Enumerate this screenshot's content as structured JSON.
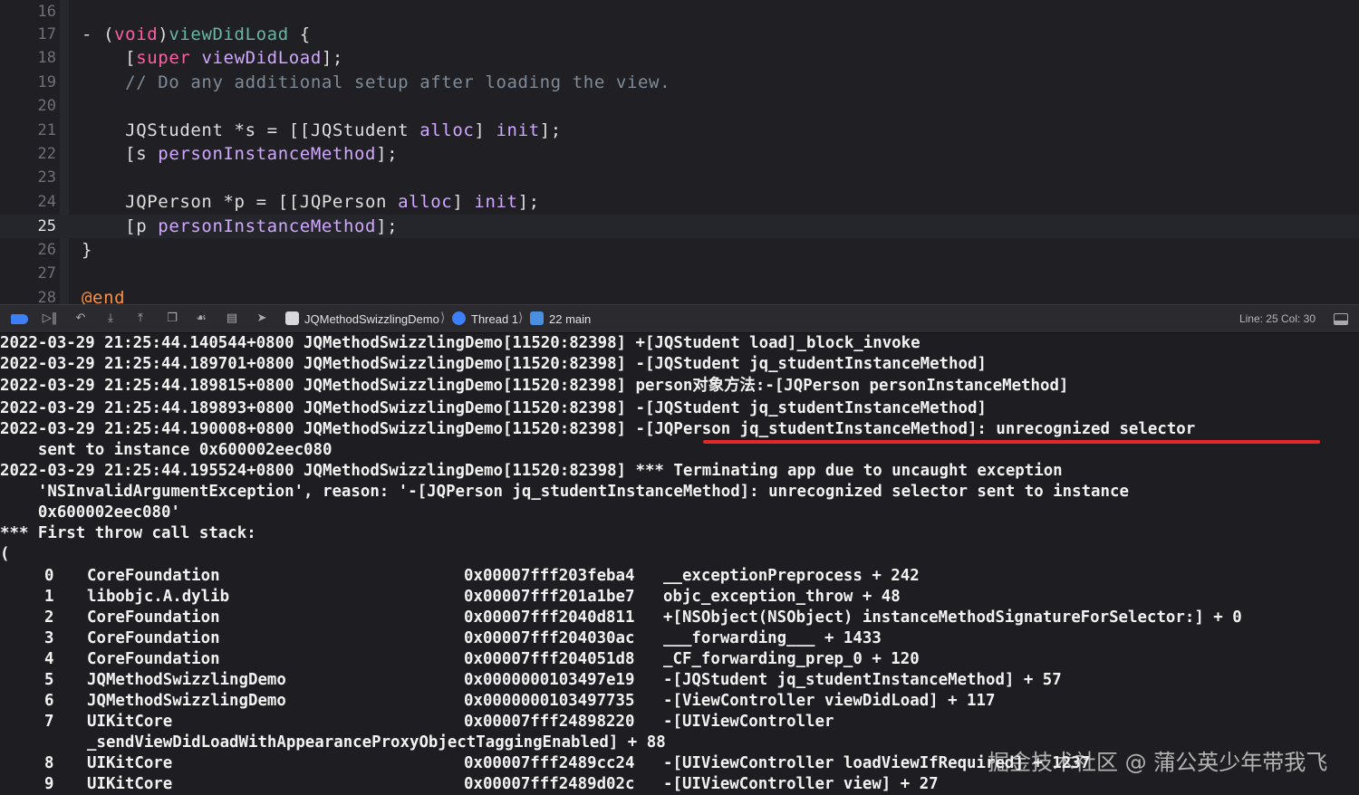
{
  "editor": {
    "lines": [
      {
        "num": "16",
        "tokens": []
      },
      {
        "num": "17",
        "tokens": [
          {
            "t": "- (",
            "c": ""
          },
          {
            "t": "void",
            "c": "kw"
          },
          {
            "t": ")",
            "c": ""
          },
          {
            "t": "viewDidLoad",
            "c": "fn"
          },
          {
            "t": " {",
            "c": ""
          }
        ]
      },
      {
        "num": "18",
        "tokens": [
          {
            "t": "    [",
            "c": ""
          },
          {
            "t": "super",
            "c": "kw"
          },
          {
            "t": " ",
            "c": ""
          },
          {
            "t": "viewDidLoad",
            "c": "cls"
          },
          {
            "t": "];",
            "c": ""
          }
        ]
      },
      {
        "num": "19",
        "tokens": [
          {
            "t": "    // Do any additional setup after loading the view.",
            "c": "cm"
          }
        ]
      },
      {
        "num": "20",
        "tokens": []
      },
      {
        "num": "21",
        "tokens": [
          {
            "t": "    JQStudent *s = [[JQStudent ",
            "c": ""
          },
          {
            "t": "alloc",
            "c": "cls"
          },
          {
            "t": "] ",
            "c": ""
          },
          {
            "t": "init",
            "c": "cls"
          },
          {
            "t": "];",
            "c": ""
          }
        ]
      },
      {
        "num": "22",
        "tokens": [
          {
            "t": "    [s ",
            "c": ""
          },
          {
            "t": "personInstanceMethod",
            "c": "cls"
          },
          {
            "t": "];",
            "c": ""
          }
        ]
      },
      {
        "num": "23",
        "tokens": []
      },
      {
        "num": "24",
        "tokens": [
          {
            "t": "    JQPerson *p = [[JQPerson ",
            "c": ""
          },
          {
            "t": "alloc",
            "c": "cls"
          },
          {
            "t": "] ",
            "c": ""
          },
          {
            "t": "init",
            "c": "cls"
          },
          {
            "t": "];",
            "c": ""
          }
        ]
      },
      {
        "num": "25",
        "tokens": [
          {
            "t": "    [p ",
            "c": ""
          },
          {
            "t": "personInstanceMethod",
            "c": "cls"
          },
          {
            "t": "];",
            "c": ""
          }
        ],
        "current": true
      },
      {
        "num": "26",
        "tokens": [
          {
            "t": "}",
            "c": ""
          }
        ]
      },
      {
        "num": "27",
        "tokens": []
      },
      {
        "num": "28",
        "tokens": [
          {
            "t": "@end",
            "c": "atk"
          }
        ]
      }
    ]
  },
  "toolbar": {
    "scheme": "JQMethodSwizzlingDemo",
    "thread": "Thread 1",
    "frame": "22 main",
    "line_col": "Line: 25  Col: 30",
    "icons": [
      "breakpoints-toggle-icon",
      "continue-icon",
      "step-over-icon",
      "step-into-icon",
      "step-out-icon",
      "view-debugger-icon",
      "memory-graph-icon",
      "environment-overrides-icon",
      "simulate-location-icon"
    ]
  },
  "console": {
    "lines": [
      "2022-03-29 21:25:44.140544+0800 JQMethodSwizzlingDemo[11520:82398] +[JQStudent load]_block_invoke",
      "2022-03-29 21:25:44.189701+0800 JQMethodSwizzlingDemo[11520:82398] -[JQStudent jq_studentInstanceMethod]",
      "2022-03-29 21:25:44.189815+0800 JQMethodSwizzlingDemo[11520:82398] person对象方法:-[JQPerson personInstanceMethod]",
      "2022-03-29 21:25:44.189893+0800 JQMethodSwizzlingDemo[11520:82398] -[JQStudent jq_studentInstanceMethod]",
      "2022-03-29 21:25:44.190008+0800 JQMethodSwizzlingDemo[11520:82398] -[JQPerson jq_studentInstanceMethod]: unrecognized selector",
      "    sent to instance 0x600002eec080",
      "2022-03-29 21:25:44.195524+0800 JQMethodSwizzlingDemo[11520:82398] *** Terminating app due to uncaught exception",
      "    'NSInvalidArgumentException', reason: '-[JQPerson jq_studentInstanceMethod]: unrecognized selector sent to instance",
      "    0x600002eec080'",
      "*** First throw call stack:",
      "("
    ],
    "stack": [
      {
        "idx": "0",
        "lib": "CoreFoundation",
        "addr": "0x00007fff203feba4",
        "sym": "__exceptionPreprocess + 242"
      },
      {
        "idx": "1",
        "lib": "libobjc.A.dylib",
        "addr": "0x00007fff201a1be7",
        "sym": "objc_exception_throw + 48"
      },
      {
        "idx": "2",
        "lib": "CoreFoundation",
        "addr": "0x00007fff2040d811",
        "sym": "+[NSObject(NSObject) instanceMethodSignatureForSelector:] + 0"
      },
      {
        "idx": "3",
        "lib": "CoreFoundation",
        "addr": "0x00007fff204030ac",
        "sym": "___forwarding___ + 1433"
      },
      {
        "idx": "4",
        "lib": "CoreFoundation",
        "addr": "0x00007fff204051d8",
        "sym": "_CF_forwarding_prep_0 + 120"
      },
      {
        "idx": "5",
        "lib": "JQMethodSwizzlingDemo",
        "addr": "0x0000000103497e19",
        "sym": "-[JQStudent jq_studentInstanceMethod] + 57"
      },
      {
        "idx": "6",
        "lib": "JQMethodSwizzlingDemo",
        "addr": "0x0000000103497735",
        "sym": "-[ViewController viewDidLoad] + 117"
      },
      {
        "idx": "7",
        "lib": "UIKitCore",
        "addr": "0x00007fff24898220",
        "sym": "-[UIViewController"
      },
      {
        "idx": "",
        "lib": "_sendViewDidLoadWithAppearanceProxyObjectTaggingEnabled] + 88",
        "addr": "",
        "sym": ""
      },
      {
        "idx": "8",
        "lib": "UIKitCore",
        "addr": "0x00007fff2489cc24",
        "sym": "-[UIViewController loadViewIfRequired] + 1237"
      },
      {
        "idx": "9",
        "lib": "UIKitCore",
        "addr": "0x00007fff2489d02c",
        "sym": "-[UIViewController view] + 27"
      }
    ]
  },
  "watermark": "掘金技术社区 @ 蒲公英少年带我飞",
  "colors": {
    "editor_bg": "#1f1f24",
    "console_bg": "#1e1e22",
    "keyword": "#fc5fa3",
    "comment": "#7f8c98",
    "method": "#d0a8ff",
    "at_end": "#fd8f3f",
    "underline": "#e3282a",
    "accent": "#3d7ff6"
  }
}
